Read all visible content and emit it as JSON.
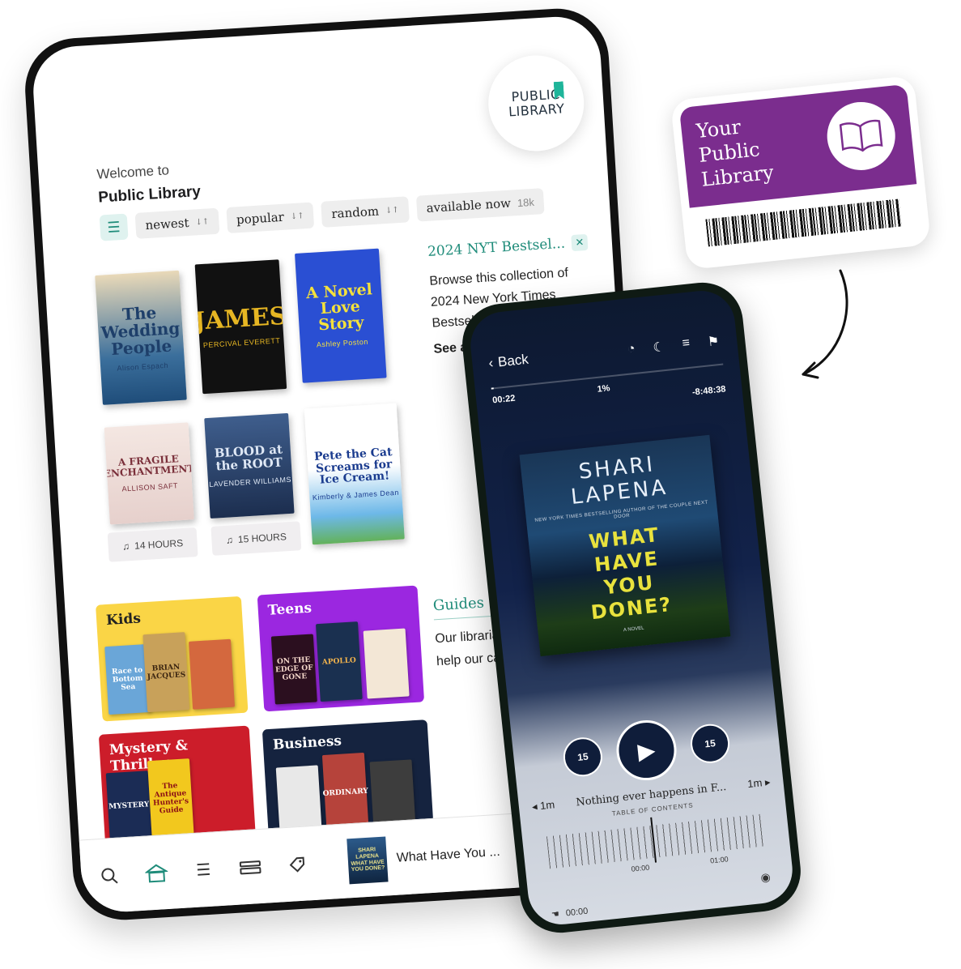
{
  "tablet": {
    "logo": {
      "line1": "PUBLIC",
      "line2": "LIBRARY"
    },
    "welcome": {
      "line1": "Welcome to",
      "line2": "Public Library"
    },
    "filters": [
      {
        "label": "newest",
        "arrow": "↓↑"
      },
      {
        "label": "popular",
        "arrow": "↓↑"
      },
      {
        "label": "random",
        "arrow": "↓↑"
      }
    ],
    "available_chip": {
      "label": "available now",
      "count": "18k"
    },
    "books": [
      {
        "title": "The Wedding People",
        "author": "Alison Espach"
      },
      {
        "title": "JAMES",
        "author": "PERCIVAL EVERETT"
      },
      {
        "title": "A Novel Love Story",
        "author": "Ashley Poston"
      },
      {
        "title": "A FRAGILE ENCHANTMENT",
        "author": "ALLISON SAFT"
      },
      {
        "title": "BLOOD at the ROOT",
        "author": "LAVENDER WILLIAMS"
      },
      {
        "title": "Pete the Cat Screams for Ice Cream!",
        "author": "Kimberly & James Dean"
      }
    ],
    "durations": [
      "14 HOURS",
      "15 HOURS"
    ],
    "collection": {
      "title": "2024 NYT Bestsel...",
      "desc": "Browse this collection of 2024 New York Times Bestsellers",
      "see_all": "See all tit"
    },
    "categories": {
      "kids": "Kids",
      "teens": "Teens",
      "mystery": "Mystery & Thriller",
      "business": "Business"
    },
    "guides": {
      "title": "Guides",
      "desc": "Our librarians guides to help our catalog."
    },
    "now_playing": {
      "title": "What Have You ...",
      "thumb": "SHARI LAPENA WHAT HAVE YOU DONE?"
    }
  },
  "card": {
    "title_lines": [
      "Your",
      "Public",
      "Library"
    ]
  },
  "phone": {
    "back_label": "Back",
    "elapsed": "00:22",
    "percent": "1%",
    "remaining": "-8:48:38",
    "progress": 0.01,
    "cover": {
      "author_lines": [
        "SHARI",
        "LAPENA"
      ],
      "tagline": "NEW YORK TIMES BESTSELLING AUTHOR OF THE COUPLE NEXT DOOR",
      "title_lines": [
        "WHAT",
        "HAVE",
        "YOU",
        "DONE?"
      ],
      "novel": "A NOVEL"
    },
    "skip_back": "15",
    "skip_forward": "15",
    "chapter": {
      "back": "1m",
      "title": "Nothing ever happens in F...",
      "forward": "1m"
    },
    "toc_label": "TABLE OF CONTENTS",
    "ticks": [
      "00:00",
      "01:00"
    ],
    "sleep_time": "00:00"
  },
  "colors": {
    "accent": "#1f8c7a",
    "card_purple": "#7b2d8e",
    "kids": "#fad546",
    "teens": "#9b27e0",
    "mystery": "#cc1d2a",
    "business": "#15233f"
  }
}
